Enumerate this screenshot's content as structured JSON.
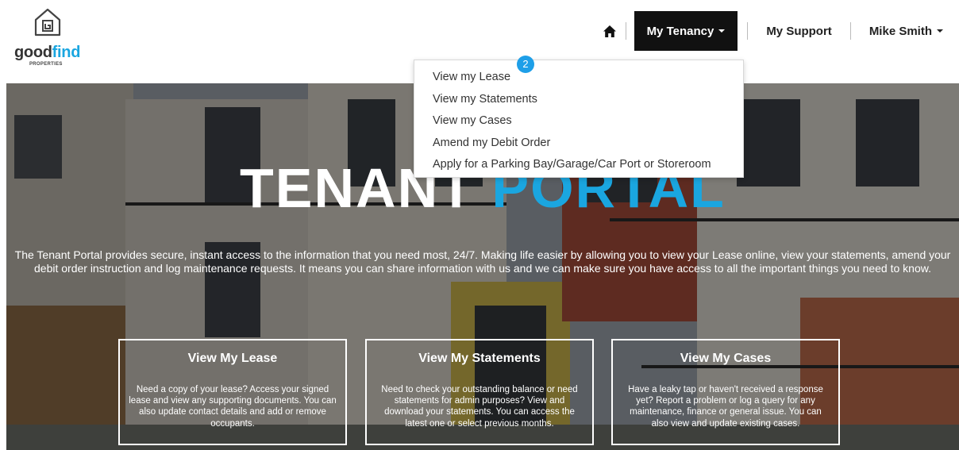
{
  "brand": {
    "name_part1": "good",
    "name_part2": "find",
    "sub": "PROPERTIES"
  },
  "nav": {
    "home_icon": "home-icon",
    "tenancy_label": "My Tenancy",
    "support_label": "My Support",
    "user_label": "Mike Smith"
  },
  "dropdown": {
    "items": [
      "View my Lease",
      "View my Statements",
      "View my Cases",
      "Amend my Debit Order",
      "Apply for a Parking Bay/Garage/Car Port or Storeroom"
    ],
    "badge": "2"
  },
  "hero": {
    "title_part1": "TENANT",
    "title_part2": "PORTAL",
    "description": "The Tenant Portal provides secure, instant access to the information that you need most, 24/7. Making life easier by allowing you to view your Lease online, view your statements, amend your debit order instruction and log maintenance requests. It means you can share information with us and we can make sure you have access to all the important things you need to know."
  },
  "cards": [
    {
      "title": "View My Lease",
      "text": "Need a copy of your lease? Access your signed lease and view any supporting documents. You can also update contact details and add or remove occupants."
    },
    {
      "title": "View My Statements",
      "text": "Need to check your outstanding balance or need statements for admin purposes? View and download your statements. You can access the latest one or select previous months."
    },
    {
      "title": "View My Cases",
      "text": "Have a leaky tap or haven't received a response yet? Report a problem or log a query for any maintenance, finance or general issue. You can also view and update existing cases."
    }
  ],
  "colors": {
    "accent": "#1aa6e0",
    "nav_active_bg": "#111111",
    "badge": "#1e9fe8"
  }
}
